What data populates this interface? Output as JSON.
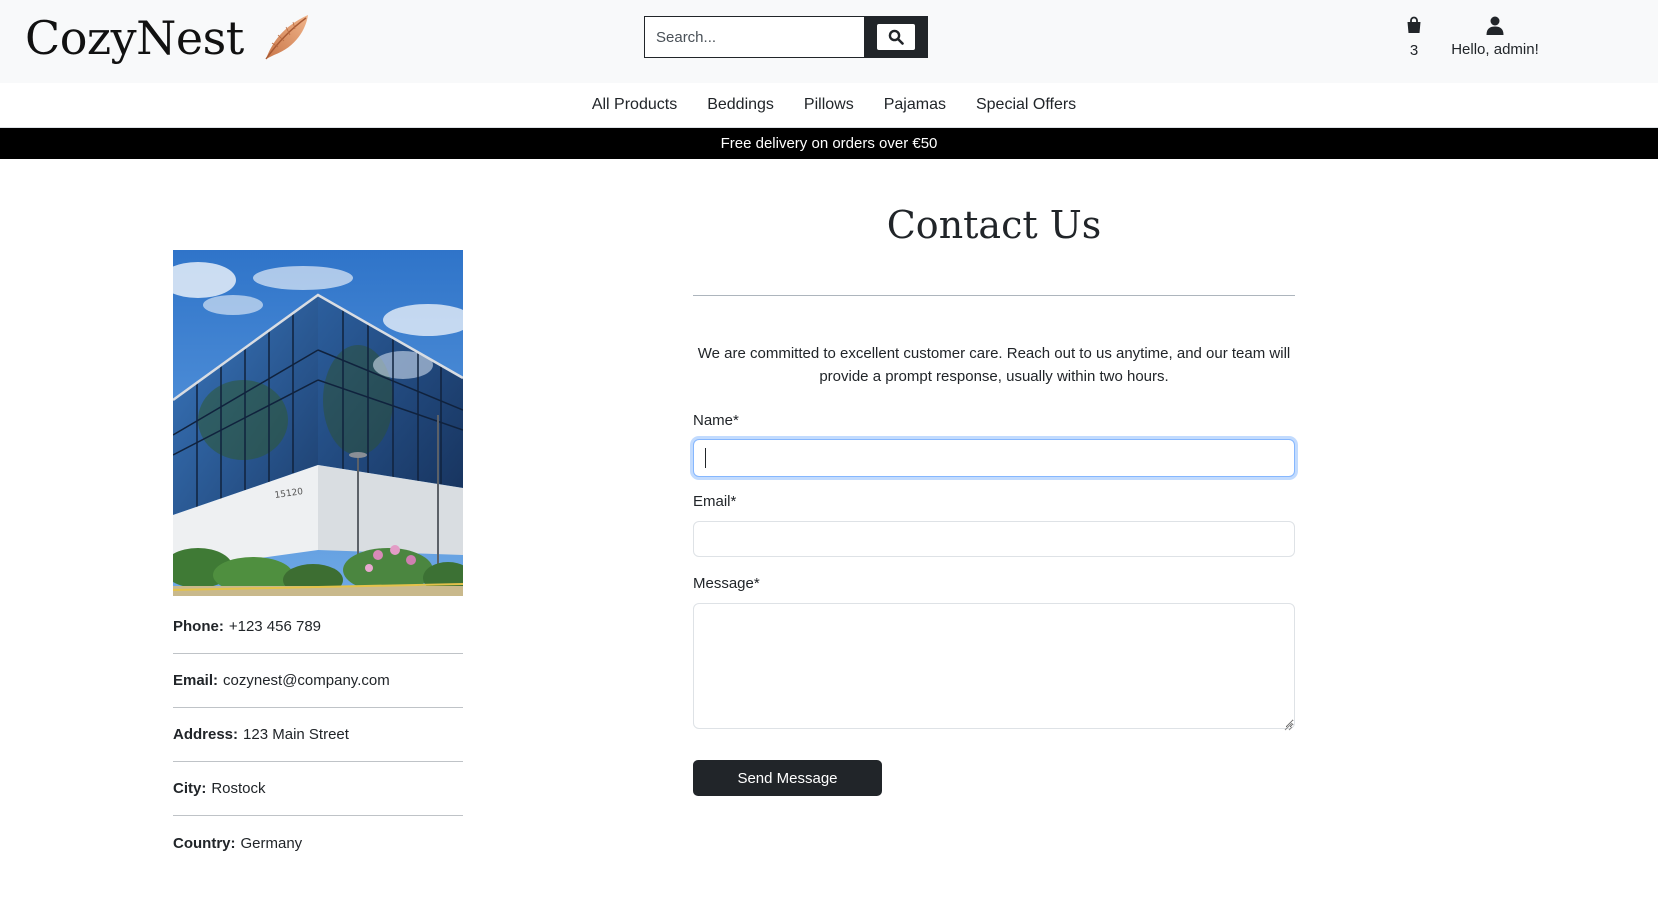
{
  "header": {
    "logo_text": "CozyNest",
    "search_placeholder": "Search...",
    "bag_count": "3",
    "account_greeting": "Hello, admin!"
  },
  "nav": {
    "items": [
      {
        "label": "All Products"
      },
      {
        "label": "Beddings"
      },
      {
        "label": "Pillows"
      },
      {
        "label": "Pajamas"
      },
      {
        "label": "Special Offers"
      }
    ]
  },
  "banner": {
    "text": "Free delivery on orders over €50"
  },
  "contact_info": {
    "phone_label": "Phone:",
    "phone_value": "+123 456 789",
    "email_label": "Email:",
    "email_value": "cozynest@company.com",
    "address_label": "Address:",
    "address_value": "123 Main Street",
    "city_label": "City:",
    "city_value": "Rostock",
    "country_label": "Country:",
    "country_value": "Germany"
  },
  "form": {
    "title": "Contact Us",
    "intro": "We are committed to excellent customer care. Reach out to us anytime, and our team will provide a prompt response, usually within two hours.",
    "name_label": "Name*",
    "name_value": "",
    "email_label": "Email*",
    "email_value": "",
    "message_label": "Message*",
    "message_value": "",
    "submit_label": "Send Message"
  },
  "icons": {
    "logo": "feather-icon",
    "search": "search-icon",
    "bag": "shopping-bag-icon",
    "account": "user-icon"
  },
  "colors": {
    "header_bg": "#f8f9fa",
    "dark": "#212529",
    "banner_bg": "#000000",
    "feather": "#d9956a",
    "focus_ring": "#86b7fe"
  }
}
